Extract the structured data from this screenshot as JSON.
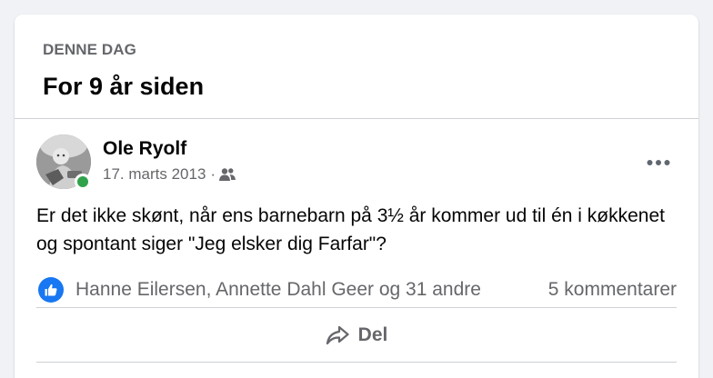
{
  "memory": {
    "section_label": "DENNE DAG",
    "title": "For 9 år siden"
  },
  "post": {
    "author": "Ole Ryolf",
    "date": "17. marts 2013",
    "meta_separator": "·",
    "audience_icon": "friends-icon",
    "text": "Er det ikke skønt, når ens barnebarn på 3½ år kommer ud til én i køkkenet og spontant siger \"Jeg elsker dig Farfar\"?",
    "reactors": "Hanne Eilersen, Annette Dahl Geer og 31 andre",
    "comments": "5 kommentarer",
    "share_label": "Del",
    "online": true
  },
  "colors": {
    "brand_blue": "#1877f2",
    "online_green": "#31a24c",
    "secondary_text": "#65676b",
    "divider": "#ced0d4"
  }
}
